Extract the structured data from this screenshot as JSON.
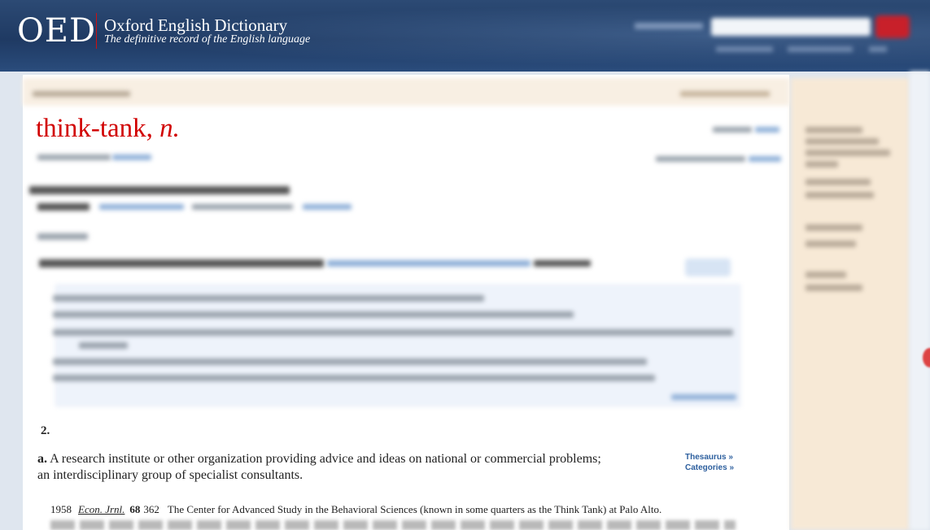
{
  "header": {
    "logo": "OED",
    "brand_name": "Oxford English Dictionary",
    "brand_tagline": "The definitive record of the English language"
  },
  "entry": {
    "headword": "think-tank,",
    "pos": "n."
  },
  "sense": {
    "number": "2.",
    "sub_label": "a.",
    "definition": "A research institute or other organization providing advice and ideas on national or commercial problems; an interdisciplinary group of specialist consultants.",
    "links": {
      "thesaurus": "Thesaurus »",
      "categories": "Categories »"
    }
  },
  "quotation": {
    "year": "1958",
    "source": "Econ. Jrnl.",
    "volume": "68",
    "page": "362",
    "text": "The Center for Advanced Study in the Behavioral Sciences (known in some quarters as the Think Tank) at Palo Alto."
  },
  "colors": {
    "header_bg": "#1f3a63",
    "headword_red": "#d10000",
    "link_blue": "#2d5f9e",
    "sidebar_bg": "#f7e9d6"
  }
}
